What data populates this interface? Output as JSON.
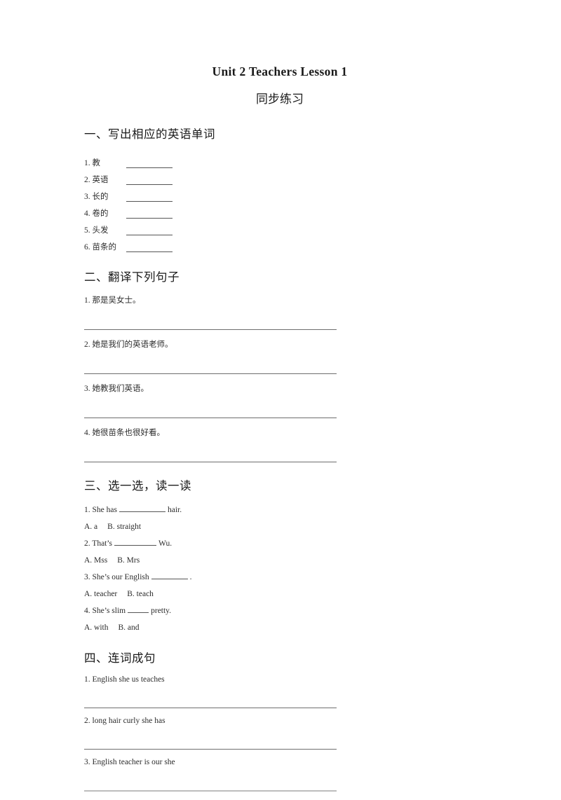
{
  "document": {
    "title": "Unit 2 Teachers  Lesson 1",
    "subtitle": "同步练习"
  },
  "sections": {
    "one": {
      "heading": "一、写出相应的英语单词",
      "items": [
        {
          "num": "1.",
          "word": "教"
        },
        {
          "num": "2.",
          "word": "英语"
        },
        {
          "num": "3.",
          "word": "长的"
        },
        {
          "num": "4.",
          "word": "卷的"
        },
        {
          "num": "5.",
          "word": "头发"
        },
        {
          "num": "6.",
          "word": "苗条的"
        }
      ]
    },
    "two": {
      "heading": "二、翻译下列句子",
      "items": [
        {
          "text": "1. 那是吴女士。"
        },
        {
          "text": "2. 她是我们的英语老师。"
        },
        {
          "text": "3. 她教我们英语。"
        },
        {
          "text": "4. 她很苗条也很好看。"
        }
      ]
    },
    "three": {
      "heading": "三、选一选，读一读",
      "items": [
        {
          "pre": "1. She has",
          "post": "hair.",
          "option_a": "A. a",
          "option_b": "B. straight"
        },
        {
          "pre": "2. That’s",
          "post": "Wu.",
          "option_a": "A. Mss",
          "option_b": "B. Mrs"
        },
        {
          "pre": "3. She’s our English",
          "post": ".",
          "option_a": "A. teacher",
          "option_b": "B. teach"
        },
        {
          "pre": "4. She’s slim",
          "post": "pretty.",
          "option_a": "A. with",
          "option_b": "B. and"
        }
      ]
    },
    "four": {
      "heading": "四、连词成句",
      "items": [
        {
          "text": "1. English she us teaches"
        },
        {
          "text": "2. long hair curly she has"
        },
        {
          "text": "3. English teacher is our she"
        }
      ]
    }
  }
}
